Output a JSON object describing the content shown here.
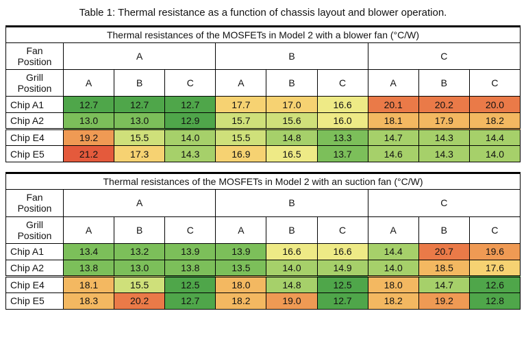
{
  "caption": "Table 1: Thermal resistance as a function of chassis layout and blower operation.",
  "row_header_labels": {
    "fan": "Fan Position",
    "grill": "Grill Position"
  },
  "fan_positions": [
    "A",
    "B",
    "C"
  ],
  "grill_positions": [
    "A",
    "B",
    "C"
  ],
  "chips": [
    "Chip A1",
    "Chip A2",
    "Chip E4",
    "Chip E5"
  ],
  "value_min": 12.5,
  "value_max": 21.2,
  "tables": [
    {
      "title": "Thermal resistances of the MOSFETs in Model 2 with a blower fan (°C/W)",
      "rows": [
        [
          12.7,
          12.7,
          12.7,
          17.7,
          17.0,
          16.6,
          20.1,
          20.2,
          20.0
        ],
        [
          13.0,
          13.0,
          12.9,
          15.7,
          15.6,
          16.0,
          18.1,
          17.9,
          18.2
        ],
        [
          19.2,
          15.5,
          14.0,
          15.5,
          14.8,
          13.3,
          14.7,
          14.3,
          14.4
        ],
        [
          21.2,
          17.3,
          14.3,
          16.9,
          16.5,
          13.7,
          14.6,
          14.3,
          14.0
        ]
      ]
    },
    {
      "title": "Thermal resistances of the MOSFETs in Model 2 with an suction fan (°C/W)",
      "rows": [
        [
          13.4,
          13.2,
          13.9,
          13.9,
          16.6,
          16.6,
          14.4,
          20.7,
          19.6
        ],
        [
          13.8,
          13.0,
          13.8,
          13.5,
          14.0,
          14.9,
          14.0,
          18.5,
          17.6
        ],
        [
          18.1,
          15.5,
          12.5,
          18.0,
          14.8,
          12.5,
          18.0,
          14.7,
          12.6
        ],
        [
          18.3,
          20.2,
          12.7,
          18.2,
          19.0,
          12.7,
          18.2,
          19.2,
          12.8
        ]
      ]
    }
  ],
  "chart_data": [
    {
      "type": "table",
      "title": "Thermal resistances of the MOSFETs in Model 2 with a blower fan (°C/W)",
      "columns": [
        "A/A",
        "A/B",
        "A/C",
        "B/A",
        "B/B",
        "B/C",
        "C/A",
        "C/B",
        "C/C"
      ],
      "row_labels": [
        "Chip A1",
        "Chip A2",
        "Chip E4",
        "Chip E5"
      ],
      "values": [
        [
          12.7,
          12.7,
          12.7,
          17.7,
          17.0,
          16.6,
          20.1,
          20.2,
          20.0
        ],
        [
          13.0,
          13.0,
          12.9,
          15.7,
          15.6,
          16.0,
          18.1,
          17.9,
          18.2
        ],
        [
          19.2,
          15.5,
          14.0,
          15.5,
          14.8,
          13.3,
          14.7,
          14.3,
          14.4
        ],
        [
          21.2,
          17.3,
          14.3,
          16.9,
          16.5,
          13.7,
          14.6,
          14.3,
          14.0
        ]
      ],
      "units": "°C/W"
    },
    {
      "type": "table",
      "title": "Thermal resistances of the MOSFETs in Model 2 with a suction fan (°C/W)",
      "columns": [
        "A/A",
        "A/B",
        "A/C",
        "B/A",
        "B/B",
        "B/C",
        "C/A",
        "C/B",
        "C/C"
      ],
      "row_labels": [
        "Chip A1",
        "Chip A2",
        "Chip E4",
        "Chip E5"
      ],
      "values": [
        [
          13.4,
          13.2,
          13.9,
          13.9,
          16.6,
          16.6,
          14.4,
          20.7,
          19.6
        ],
        [
          13.8,
          13.0,
          13.8,
          13.5,
          14.0,
          14.9,
          14.0,
          18.5,
          17.6
        ],
        [
          18.1,
          15.5,
          12.5,
          18.0,
          14.8,
          12.5,
          18.0,
          14.7,
          12.6
        ],
        [
          18.3,
          20.2,
          12.7,
          18.2,
          19.0,
          12.7,
          18.2,
          19.2,
          12.8
        ]
      ],
      "units": "°C/W"
    }
  ]
}
